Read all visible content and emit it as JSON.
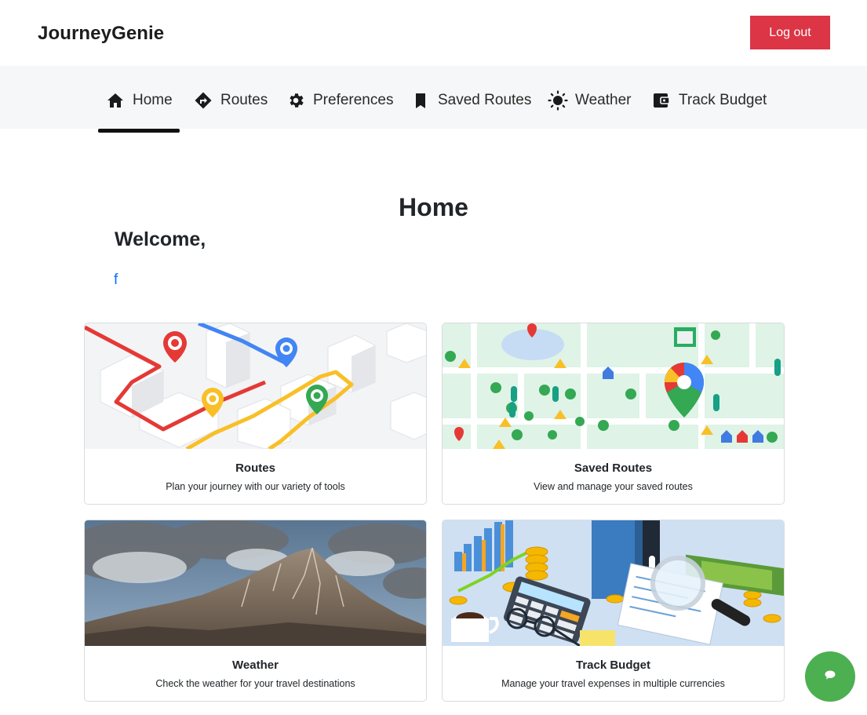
{
  "header": {
    "brand": "JourneyGenie",
    "logout_label": "Log out"
  },
  "nav": {
    "items": [
      {
        "label": "Home",
        "icon": "home-icon",
        "active": true
      },
      {
        "label": "Routes",
        "icon": "directions-icon",
        "active": false
      },
      {
        "label": "Preferences",
        "icon": "gear-icon",
        "active": false
      },
      {
        "label": "Saved Routes",
        "icon": "bookmark-icon",
        "active": false
      },
      {
        "label": "Weather",
        "icon": "sun-icon",
        "active": false
      },
      {
        "label": "Track Budget",
        "icon": "wallet-icon",
        "active": false
      }
    ]
  },
  "main": {
    "title": "Home",
    "welcome": "Welcome,",
    "username": "f",
    "cards": [
      {
        "title": "Routes",
        "description": "Plan your journey with our variety of tools",
        "image": "route-map-illustration"
      },
      {
        "title": "Saved Routes",
        "description": "View and manage your saved routes",
        "image": "map-pins-illustration"
      },
      {
        "title": "Weather",
        "description": "Check the weather for your travel destinations",
        "image": "mountain-photo"
      },
      {
        "title": "Track Budget",
        "description": "Manage your travel expenses in multiple currencies",
        "image": "finance-illustration"
      }
    ]
  },
  "chat": {
    "icon": "chat-icon"
  },
  "colors": {
    "logout": "#dc3545",
    "nav_background": "#f6f7f8",
    "link": "#0d6efd",
    "chat": "#4caf50"
  }
}
